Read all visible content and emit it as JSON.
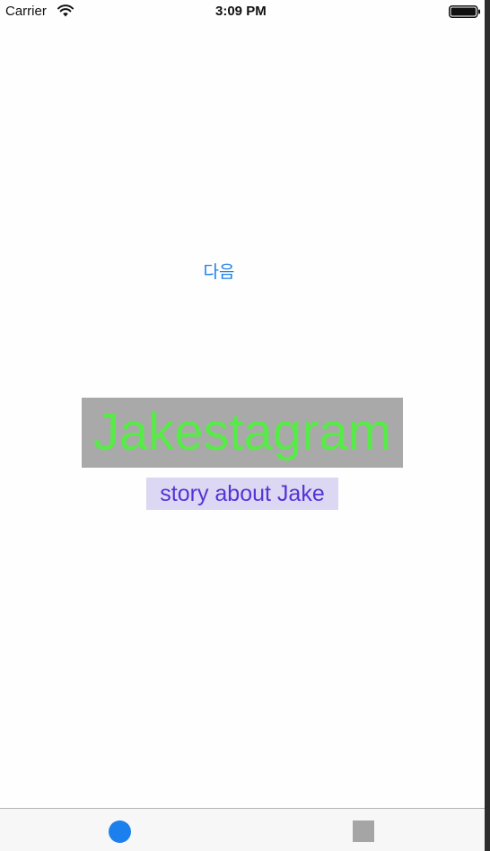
{
  "status_bar": {
    "carrier": "Carrier",
    "time": "3:09 PM",
    "wifi_icon": "wifi-icon",
    "battery_icon": "battery-full-icon"
  },
  "main": {
    "next_button_label": "다음",
    "title": "Jakestagram",
    "subtitle": "story about Jake"
  },
  "tab_bar": {
    "items": [
      {
        "icon": "circle-icon",
        "selected": true
      },
      {
        "icon": "square-icon",
        "selected": false
      }
    ]
  },
  "colors": {
    "link_blue": "#1a80ea",
    "title_green": "#58ea48",
    "title_background": "#a9a9a9",
    "subtitle_purple": "#5434d6",
    "subtitle_background": "#dcd7f2",
    "tab_selected": "#1b80ee",
    "tab_unselected": "#a5a5a5"
  }
}
